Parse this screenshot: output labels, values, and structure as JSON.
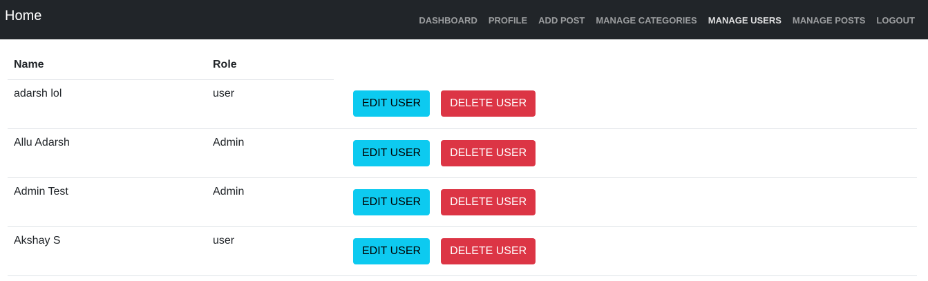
{
  "navbar": {
    "brand": "Home",
    "links": [
      {
        "label": "DASHBOARD",
        "name": "nav-dashboard",
        "active": false
      },
      {
        "label": "PROFILE",
        "name": "nav-profile",
        "active": false
      },
      {
        "label": "ADD POST",
        "name": "nav-add-post",
        "active": false
      },
      {
        "label": "MANAGE CATEGORIES",
        "name": "nav-manage-categories",
        "active": false
      },
      {
        "label": "MANAGE USERS",
        "name": "nav-manage-users",
        "active": true
      },
      {
        "label": "MANAGE POSTS",
        "name": "nav-manage-posts",
        "active": false
      },
      {
        "label": "LOGOUT",
        "name": "nav-logout",
        "active": false
      }
    ]
  },
  "table": {
    "headers": {
      "name": "Name",
      "role": "Role"
    },
    "edit_label": "EDIT USER",
    "delete_label": "DELETE USER",
    "rows": [
      {
        "name": "adarsh lol",
        "role": "user"
      },
      {
        "name": "Allu Adarsh",
        "role": "Admin"
      },
      {
        "name": "Admin Test",
        "role": "Admin"
      },
      {
        "name": "Akshay S",
        "role": "user"
      }
    ]
  },
  "colors": {
    "navbar_bg": "#212529",
    "edit_button": "#0dcaf0",
    "delete_button": "#dc3545"
  }
}
